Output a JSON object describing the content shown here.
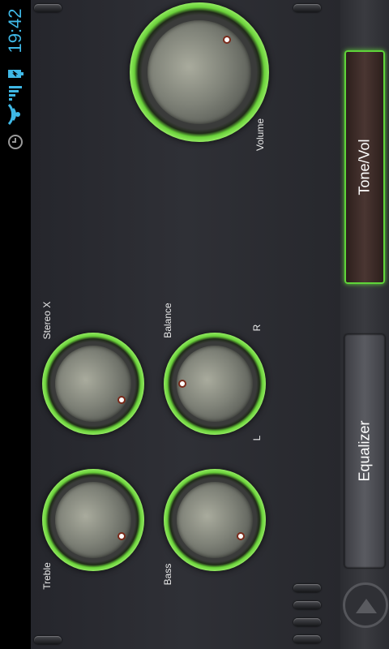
{
  "status": {
    "time": "19:42",
    "icons": [
      "battery-icon",
      "signal-icon",
      "wifi-icon",
      "alarm-icon"
    ]
  },
  "knobs": {
    "volume": {
      "label": "Volume"
    },
    "stereo_x": {
      "label": "Stereo X"
    },
    "balance": {
      "label": "Balance",
      "left_label": "L",
      "right_label": "R"
    },
    "treble": {
      "label": "Treble"
    },
    "bass": {
      "label": "Bass"
    }
  },
  "tabs": {
    "tone_vol": "Tone/Vol",
    "equalizer": "Equalizer"
  },
  "colors": {
    "accent_green": "#6ad23a",
    "status_blue": "#3fb8e6"
  }
}
